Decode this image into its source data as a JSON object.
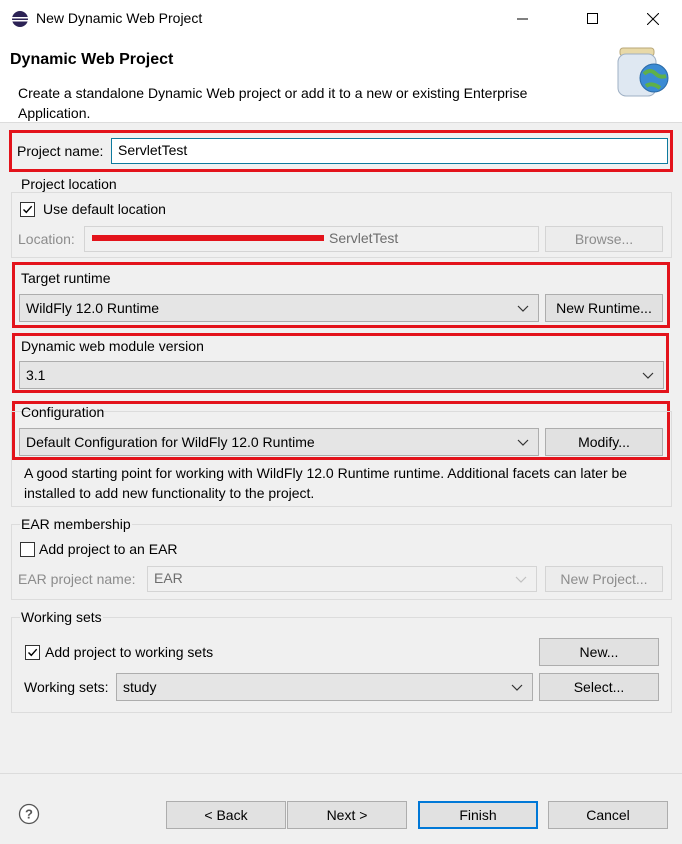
{
  "window": {
    "title": "New Dynamic Web Project",
    "minimize_icon": "minimize-icon",
    "maximize_icon": "maximize-icon",
    "close_icon": "close-icon"
  },
  "header": {
    "title": "Dynamic Web Project",
    "description": "Create a standalone Dynamic Web project or add it to a new or existing Enterprise Application."
  },
  "project_name": {
    "label": "Project name:",
    "value": "ServletTest"
  },
  "project_location": {
    "group_label": "Project location",
    "use_default_label": "Use default location",
    "use_default_checked": true,
    "location_label": "Location:",
    "location_value": "ServletTest",
    "browse_label": "Browse..."
  },
  "target_runtime": {
    "group_label": "Target runtime",
    "selected": "WildFly 12.0 Runtime",
    "new_runtime_label": "New Runtime..."
  },
  "web_module": {
    "group_label": "Dynamic web module version",
    "selected": "3.1"
  },
  "configuration": {
    "group_label": "Configuration",
    "selected": "Default Configuration for WildFly 12.0 Runtime",
    "modify_label": "Modify...",
    "description": "A good starting point for working with WildFly 12.0 Runtime runtime. Additional facets can later be installed to add new functionality to the project."
  },
  "ear": {
    "group_label": "EAR membership",
    "add_label": "Add project to an EAR",
    "add_checked": false,
    "ear_name_label": "EAR project name:",
    "ear_name_value": "EAR",
    "new_project_label": "New Project..."
  },
  "working_sets": {
    "group_label": "Working sets",
    "add_label": "Add project to working sets",
    "add_checked": true,
    "new_label": "New...",
    "sets_label": "Working sets:",
    "sets_value": "study",
    "select_label": "Select..."
  },
  "footer": {
    "help_icon": "help-icon",
    "back_label": "< Back",
    "next_label": "Next >",
    "finish_label": "Finish",
    "cancel_label": "Cancel"
  },
  "colors": {
    "highlight": "#e3131b",
    "dialog_bg": "#f0f0f0",
    "focus": "#0078d7"
  }
}
